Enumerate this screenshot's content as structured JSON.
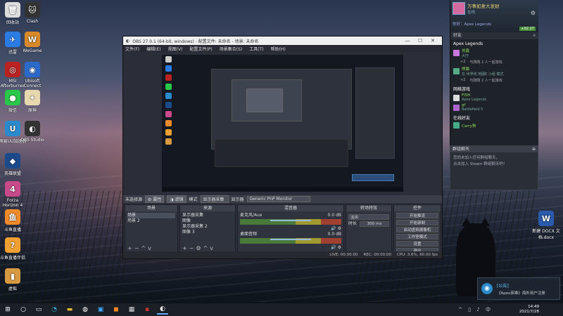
{
  "desktop": {
    "icons": [
      {
        "label": "回收站",
        "glyph": "🗑",
        "color": "#ddd"
      },
      {
        "label": "Clash",
        "glyph": "🐱",
        "color": "#333"
      },
      {
        "label": "迅雷",
        "glyph": "✈",
        "color": "#2a7be4"
      },
      {
        "label": "WeGame",
        "glyph": "W",
        "color": "#d88a2a"
      },
      {
        "label": "MSI Afterburner",
        "glyph": "◎",
        "color": "#b22"
      },
      {
        "label": "Ubisoft Connect",
        "glyph": "◉",
        "color": "#2a6acb"
      },
      {
        "label": "微信",
        "glyph": "●",
        "color": "#2ac84a"
      },
      {
        "label": "原神",
        "glyph": "✦",
        "color": "#e8d8b0"
      },
      {
        "label": "网易UU加速器",
        "glyph": "U",
        "color": "#2a8acb"
      },
      {
        "label": "OBS Studio",
        "glyph": "◐",
        "color": "#333"
      },
      {
        "label": "英雄联盟",
        "glyph": "◆",
        "color": "#1a4a8a"
      },
      {
        "label": "Forza Horizon 4",
        "glyph": "4",
        "color": "#c84a8a"
      },
      {
        "label": "斗鱼直播",
        "glyph": "鱼",
        "color": "#f08a2a"
      },
      {
        "label": "斗鱼直播伴侣",
        "glyph": "?",
        "color": "#f0a030"
      },
      {
        "label": "虚拟",
        "glyph": "▮",
        "color": "#d89a40"
      },
      {
        "label": "新建 DOCX 文档.docx",
        "glyph": "W",
        "color": "#2a5aab"
      }
    ]
  },
  "obs": {
    "title": "OBS 27.0.1 (64-bit, windows) - 配置文件: 未命名 - 场景: 未命名",
    "menu": [
      "文件(F)",
      "编辑(E)",
      "视图(V)",
      "配置文件(P)",
      "场景集合(S)",
      "工具(T)",
      "帮助(H)"
    ],
    "scenebar": {
      "no_source": "未选择源",
      "properties": "属性",
      "filters": "滤镜",
      "mode_label": "模式",
      "mode_value": "显示器采集",
      "display_label": "显示器",
      "display_value": "Generic PnP Monitor"
    },
    "docks": {
      "scenes": {
        "title": "场景",
        "items": [
          "场景",
          "场景 2"
        ]
      },
      "sources": {
        "title": "来源",
        "items": [
          "显示器采集",
          "图像",
          "显示器采集 2",
          "图像 3"
        ]
      },
      "mixer": {
        "title": "混音器",
        "tracks": [
          {
            "name": "麦克风/Aux",
            "db": "0.0 dB"
          },
          {
            "name": "桌面音频",
            "db": "0.0 dB"
          }
        ]
      },
      "transitions": {
        "title": "转场特效",
        "type": "淡出",
        "duration_label": "时长",
        "duration": "300 ms"
      },
      "controls": {
        "title": "控件",
        "buttons": [
          "开始推流",
          "开始录制",
          "启动虚拟摄像机",
          "工作室模式",
          "设置",
          "退出"
        ]
      }
    },
    "status": {
      "live": "LIVE: 00:00:00",
      "rec": "REC: 00:00:00",
      "cpu": "CPU: 3.6%, 60.00 fps"
    }
  },
  "friends": {
    "username": "万事如意大发财",
    "status": "在线",
    "now_playing": "你好：Apex Legends",
    "badge": "+92 27",
    "search_label": "好友",
    "groups": [
      {
        "title": "Apex Legends",
        "rows": [
          {
            "name": "刘鑫",
            "state": "大厅",
            "color": "#c7d"
          },
          {
            "name": "+2",
            "state": "与刚刚 2 人一起游戏",
            "color": ""
          },
          {
            "name": "熊猫",
            "state": "在 世界线 地图E 小组 模式",
            "color": "#5a8"
          },
          {
            "name": "+2",
            "state": "与刚刚 2 人一起游戏",
            "color": ""
          }
        ]
      },
      {
        "title": "网络游戏",
        "rows": [
          {
            "name": "FISH",
            "state": "Apex Legends",
            "color": "#ddd"
          },
          {
            "name": "gf",
            "state": "Battlefield 5",
            "color": "#a6c"
          }
        ]
      },
      {
        "title": "在线好友",
        "rows": [
          {
            "name": "Carry狗",
            "state": "",
            "color": "#4a8"
          }
        ]
      }
    ],
    "chat": {
      "title": "群组聊天",
      "line1": "您尚未加入任何群组聊天，",
      "line2": "点击加入 Steam 群组聊天吧！"
    }
  },
  "notification": {
    "title": "[公告]",
    "body": "《Apex英雄》海外用户注册"
  },
  "taskbar": {
    "time": "14:49",
    "date": "2021/7/28"
  }
}
